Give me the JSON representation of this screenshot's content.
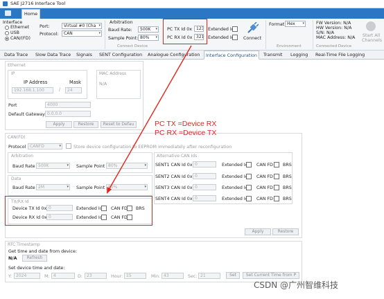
{
  "window": {
    "title": "SAE J2716 Interface Tool"
  },
  "menu": {
    "home": "Home"
  },
  "ribbon": {
    "interface": {
      "label": "Interface",
      "options": [
        "Ethernet",
        "USB",
        "CAN/(FD)"
      ],
      "selected": 2
    },
    "port": {
      "label": "Port:",
      "value": "Virtual #0 (Cha"
    },
    "protocol": {
      "label": "Protocol:",
      "value": "CAN"
    },
    "arbitration": {
      "title": "Arbitration",
      "baud_label": "Baud Rate:",
      "baud_value": "500K",
      "sample_label": "Sample Point:",
      "sample_value": "80%"
    },
    "pc_ids": {
      "tx_label": "PC TX Id  0x",
      "tx_value": "123",
      "rx_label": "PC RX Id  0x",
      "rx_value": "321",
      "ext_label": "Extended Id"
    },
    "connect": {
      "label": "Connect"
    },
    "connect_device_label": "Connect Device",
    "format": {
      "label": "Format",
      "value": "Hex"
    },
    "environment_label": "Environment",
    "device_info": {
      "fw": "FW Version: N/A",
      "hw": "HW Version: N/A",
      "sn": "S/N: N/A",
      "mac": "MAC Address: N/A"
    },
    "connected_device_label": "Connected Device",
    "start_all": {
      "line1": "Start All",
      "line2": "Channels"
    }
  },
  "tabs": [
    "Data Trace",
    "Slow Data Trace",
    "Signals",
    "SENT Configuration",
    "Analogue Configuration",
    "Interface Configuration",
    "Transmit",
    "Logging",
    "Real-Time File Logging"
  ],
  "active_tab": 5,
  "ethernet": {
    "title": "Ethernet",
    "ip_label": "IP",
    "ip_address_label": "IP Address",
    "mask_label": "Mask",
    "ip_value": "192.168.1.100",
    "mask_value": "24",
    "mac_label": "MAC Address",
    "mac_value": "N/A",
    "port_label": "Port",
    "port_value": "4000",
    "gateway_label": "Default Gateway",
    "gateway_value": "0.0.0.0",
    "apply": "Apply",
    "restore": "Restore",
    "reset": "Reset to Defau"
  },
  "canfd": {
    "title": "CAN(FD)",
    "protocol_label": "Protocol",
    "protocol_value": "CANFD",
    "store_label": "Store device configuration to EEPROM immediately after reconfiguration",
    "arbitration_title": "Arbitration",
    "baud_label": "Baud Rate",
    "baud_value": "500K",
    "sample_label": "Sample Point",
    "sample_value": "80%",
    "data_title": "Data",
    "data_baud_value": "2M",
    "data_sample_value": "80%",
    "alt_title": "Alternative CAN Ids",
    "sent_rows": [
      {
        "label": "SENT1 CAN Id 0x",
        "value": "0"
      },
      {
        "label": "SENT2 CAN Id 0x",
        "value": "0"
      },
      {
        "label": "SENT3 CAN Id 0x",
        "value": "0"
      },
      {
        "label": "SENT4 CAN Id 0x",
        "value": "0"
      }
    ],
    "ext_label": "Extended Id",
    "canfd_label": "CAN FD",
    "brs_label": "BRS",
    "txrx_title": "TX/RX Id",
    "device_tx_label": "Device TX Id 0x",
    "device_tx_value": "0",
    "device_rx_label": "Device RX Id 0x",
    "device_rx_value": "0",
    "apply": "Apply",
    "restore": "Restore"
  },
  "rtc": {
    "title": "RTC Timestamp",
    "get_label": "Get time and date from device:",
    "value": "N/A",
    "refresh": "Refresh",
    "set_label": "Set device time and date:",
    "fields": [
      {
        "label": "Y:",
        "value": "2024"
      },
      {
        "label": "M:",
        "value": "4"
      },
      {
        "label": "D:",
        "value": "23"
      },
      {
        "label": "Hour:",
        "value": "15"
      },
      {
        "label": "Min:",
        "value": "43"
      },
      {
        "label": "Sec:",
        "value": "21"
      }
    ],
    "set_btn": "Set",
    "set_current": "Set Current Time from P"
  },
  "annotation": {
    "line1": "PC TX =Device RX",
    "line2": "PC RX =Device TX"
  },
  "watermark": "CSDN @广州智维科技",
  "colors": {
    "accent": "#2b77c3",
    "annotation": "#e5231c"
  }
}
